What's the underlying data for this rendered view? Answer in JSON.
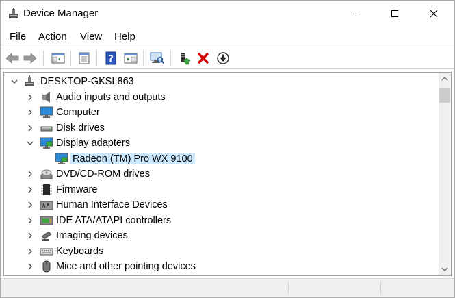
{
  "window": {
    "title": "Device Manager"
  },
  "menu": [
    "File",
    "Action",
    "View",
    "Help"
  ],
  "toolbar": {
    "buttons": [
      "back-icon",
      "forward-icon",
      "show-hide-console-tree-icon",
      "properties-icon",
      "help-icon",
      "view-icon",
      "scan-hardware-icon",
      "update-driver-icon",
      "uninstall-icon",
      "disable-icon"
    ]
  },
  "tree": {
    "root": "DESKTOP-GKSL863",
    "items": [
      {
        "label": "Audio inputs and outputs",
        "icon": "speaker-icon",
        "expanded": false
      },
      {
        "label": "Computer",
        "icon": "monitor-icon",
        "expanded": false
      },
      {
        "label": "Disk drives",
        "icon": "disk-drive-icon",
        "expanded": false
      },
      {
        "label": "Display adapters",
        "icon": "display-adapter-icon",
        "expanded": true
      },
      {
        "label": "Radeon (TM) Pro WX 9100",
        "icon": "display-adapter-icon",
        "child": true,
        "selected": true
      },
      {
        "label": "DVD/CD-ROM drives",
        "icon": "dvd-drive-icon",
        "expanded": false
      },
      {
        "label": "Firmware",
        "icon": "firmware-chip-icon",
        "expanded": false
      },
      {
        "label": "Human Interface Devices",
        "icon": "hid-icon",
        "expanded": false
      },
      {
        "label": "IDE ATA/ATAPI controllers",
        "icon": "ide-controller-icon",
        "expanded": false
      },
      {
        "label": "Imaging devices",
        "icon": "camera-icon",
        "expanded": false
      },
      {
        "label": "Keyboards",
        "icon": "keyboard-icon",
        "expanded": false
      },
      {
        "label": "Mice and other pointing devices",
        "icon": "mouse-icon",
        "expanded": false
      }
    ]
  },
  "colors": {
    "selection": "#cce8ff",
    "accent_green": "#3a8f3a",
    "delete_red": "#d40000"
  }
}
